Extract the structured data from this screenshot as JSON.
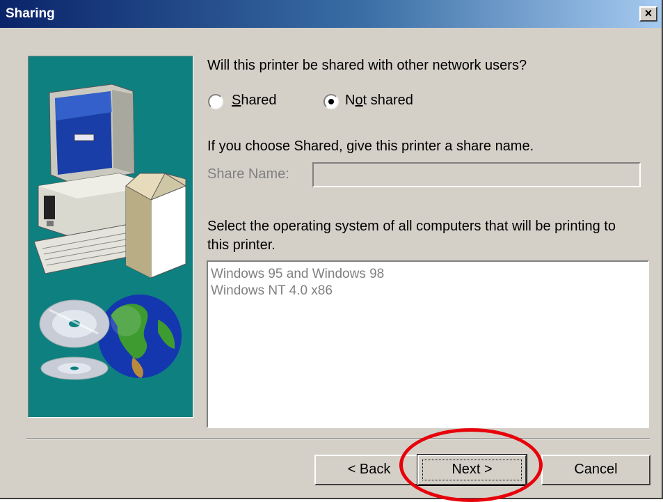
{
  "window": {
    "title": "Sharing"
  },
  "titlebar": {
    "close_glyph": "×",
    "close_icon": "close-icon"
  },
  "main": {
    "question": "Will this printer be shared with other network users?",
    "radios": [
      {
        "label": "Shared",
        "mnemonic": "S",
        "checked": false
      },
      {
        "label": "Not shared",
        "mnemonic": "o",
        "checked": true
      }
    ],
    "share_hint": "If you choose Shared, give this printer a share name.",
    "share_name_label": "Share Name:",
    "share_name_value": "",
    "os_instruction_line1": "Select the operating system of all computers that will be printing to",
    "os_instruction_line2": "this printer.",
    "os_list": [
      "Windows 95 and Windows 98",
      "Windows NT 4.0 x86"
    ]
  },
  "buttons": {
    "back": "< Back",
    "next": "Next >",
    "cancel": "Cancel"
  },
  "colors": {
    "window_face": "#d4d0c8",
    "titlebar_start": "#0a246a",
    "titlebar_end": "#a6caf0",
    "art_background": "#0e8080",
    "highlight_ring": "#e8000a"
  }
}
